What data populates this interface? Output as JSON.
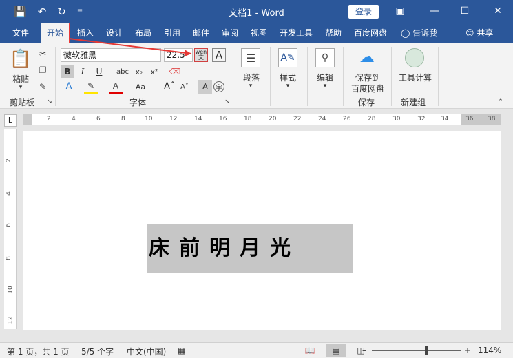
{
  "titlebar": {
    "save_icon": "save-icon",
    "undo_icon": "undo-icon",
    "redo_icon": "redo-icon",
    "customize_icon": "customize-qat-icon",
    "title": "文档1  -  Word",
    "login": "登录",
    "ribbon_display_icon": "ribbon-display-icon",
    "minimize_icon": "minimize-icon",
    "maximize_icon": "maximize-icon",
    "close_icon": "close-icon"
  },
  "tabs": {
    "file": "文件",
    "home": "开始",
    "insert": "插入",
    "design": "设计",
    "layout": "布局",
    "references": "引用",
    "mailings": "邮件",
    "review": "审阅",
    "view": "视图",
    "developer": "开发工具",
    "help": "帮助",
    "baidu": "百度网盘",
    "tellme": "告诉我",
    "share": "共享"
  },
  "ribbon": {
    "paste": "粘贴",
    "clipboard_label": "剪贴板",
    "font_name": "微软雅黑",
    "font_size": "22.5",
    "font_label": "字体",
    "paragraph": "段落",
    "styles": "样式",
    "editing": "编辑",
    "save_to_baidu_line1": "保存到",
    "save_to_baidu_line2": "百度网盘",
    "save_label": "保存",
    "tool_calc": "工具计算",
    "new_group_label": "新建组",
    "phonetic_top": "wén",
    "phonetic_bottom": "文"
  },
  "ruler": {
    "top_numbers": [
      "2",
      "4",
      "6",
      "8",
      "10",
      "12",
      "14",
      "16",
      "18",
      "20",
      "22",
      "24",
      "26",
      "28",
      "30",
      "32",
      "34",
      "36",
      "38"
    ],
    "left_numbers": [
      "2",
      "4",
      "6",
      "8",
      "10",
      "12"
    ]
  },
  "document": {
    "text": "床前明月光"
  },
  "statusbar": {
    "page": "第 1 页，共 1 页",
    "words": "5/5 个字",
    "language": "中文(中国)",
    "zoom": "114%"
  }
}
